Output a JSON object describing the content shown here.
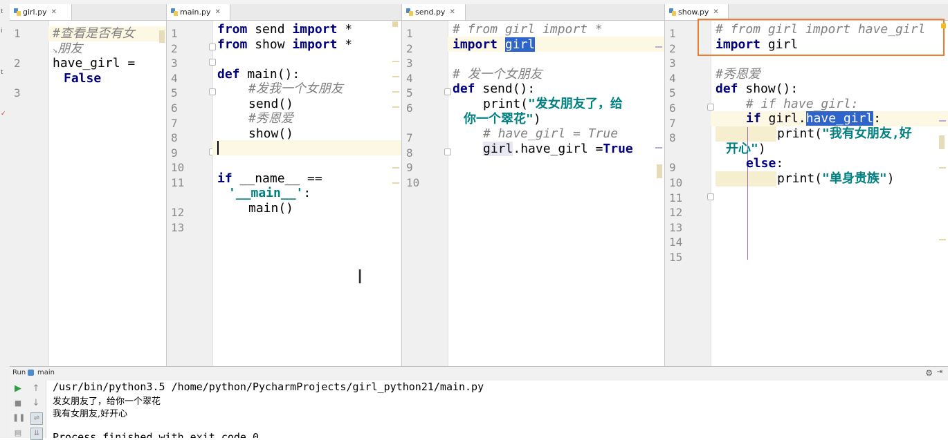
{
  "tabs": {
    "girl": "girl.py",
    "main": "main.py",
    "send": "send.py",
    "show": "show.py"
  },
  "girl": {
    "line_numbers": [
      "1",
      "2",
      "3"
    ],
    "l1": "#查看是否有女",
    "l1_wrap": "朋友",
    "l2": "have_girl =",
    "l2_wrap": "False"
  },
  "main": {
    "line_numbers": [
      "1",
      "2",
      "3",
      "4",
      "5",
      "6",
      "7",
      "8",
      "9",
      "10",
      "11",
      "12",
      "13"
    ],
    "l1_kw1": "from",
    "l1_mod": " send ",
    "l1_kw2": "import",
    "l1_star": " *",
    "l2_kw1": "from",
    "l2_mod": " show ",
    "l2_kw2": "import",
    "l2_star": " *",
    "l4_kw": "def",
    "l4_rest": " main():",
    "l5": "#发我一个女朋友",
    "l6": "send()",
    "l7": "#秀恩爱",
    "l8": "show()",
    "l11_kw": "if",
    "l11_rest": " __name__ ==",
    "l11_wrap_str": "'__main__'",
    "l11_wrap_colon": ":",
    "l12": "main()"
  },
  "send": {
    "line_numbers": [
      "1",
      "2",
      "3",
      "4",
      "5",
      "6",
      "7",
      "8",
      "9",
      "10"
    ],
    "l1": "# from girl import *",
    "l2_kw": "import",
    "l2_mod": "girl",
    "l4": "# 发一个女朋友",
    "l5_kw": "def",
    "l5_rest": " send():",
    "l6_fn": "print(",
    "l6_str": "\"发女朋友了，给",
    "l6_wrap_str": "你一个翠花\"",
    "l6_wrap_close": ")",
    "l7": "# have_girl = True",
    "l8_obj": "girl",
    "l8_attr": ".have_girl =",
    "l8_kw": "True"
  },
  "show": {
    "line_numbers": [
      "1",
      "2",
      "3",
      "4",
      "5",
      "6",
      "7",
      "8",
      "9",
      "10",
      "11",
      "12",
      "13",
      "14",
      "15"
    ],
    "l1": "# from girl import have_girl",
    "l2_kw": "import",
    "l2_mod": " girl",
    "l4": "#秀恩爱",
    "l5_kw": "def",
    "l5_rest": " show():",
    "l6": "# if have_girl:",
    "l7_kw": "if",
    "l7_obj": " girl.",
    "l7_attr": "have_girl",
    "l7_colon": ":",
    "l8_fn": "print(",
    "l8_str": "\"我有女朋友,好",
    "l8_wrap_str": "开心\"",
    "l8_wrap_close": ")",
    "l9_kw": "else",
    "l9_colon": ":",
    "l10_fn": "print(",
    "l10_str": "\"单身贵族\"",
    "l10_close": ")"
  },
  "run": {
    "label": "Run",
    "config": "main",
    "output": [
      "/usr/bin/python3.5 /home/python/PycharmProjects/girl_python21/main.py",
      "发女朋友了，给你一个翠花",
      "我有女朋友,好开心",
      "",
      "Process finished with exit code 0"
    ]
  },
  "colors": {
    "keyword": "#000080",
    "comment": "#808080",
    "string": "#008080",
    "selection": "#2f65ca",
    "current_line": "#fcf8e4",
    "highlight_box": "#f07c2c"
  }
}
